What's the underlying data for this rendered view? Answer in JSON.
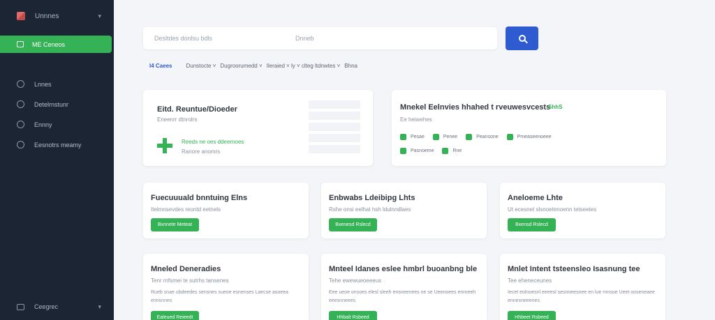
{
  "sidebar": {
    "top_label": "Unnnes",
    "active_label": "ME Ceneos",
    "items": [
      {
        "label": "Lnnes"
      },
      {
        "label": "Detelrnstunr"
      },
      {
        "label": "Ennny"
      },
      {
        "label": "Eesnotrs meamy"
      }
    ],
    "bottom_label": "Ceegrec"
  },
  "search": {
    "query_placeholder": "Desltdes donlsu bdls",
    "location_placeholder": "Dnneb"
  },
  "filters": {
    "active": "I4 Caees",
    "items": [
      "Dunstocte ˅",
      "Dugroorumedd ˅",
      "Ileraied ˅ ly ˅ clteg ltdnwtes ˅",
      "Bhna"
    ]
  },
  "card_post": {
    "title": "Eitd. Reuntue/Dioeder",
    "subtitle": "Eneenrr dtnrolrs",
    "link1": "Reeds ne oes ddeernoes",
    "link2": "Ranore anomrs"
  },
  "card_skills": {
    "title": "Mnekel Eelnvies hhahed t rveuwesvcests",
    "badge": "ShhS",
    "subtitle": "Ee heiwehes",
    "chips": [
      "Pesae",
      "Penee",
      "Peansone",
      "Pmeaseenoeee",
      "Pasnoeme",
      "Rne"
    ]
  },
  "jobs": [
    {
      "title": "Fuecuuuald bnntuing Elns",
      "sub": "Itelmnsevdes reontd eetnels",
      "desc": "",
      "apply": "Bxnnete Meteat"
    },
    {
      "title": "Enbwabs Ldeibipg Lhts",
      "sub": "Rshe onsi eelhat hsh ldulnndlaes",
      "desc": "",
      "apply": "Bxenesd Rslecd"
    },
    {
      "title": "Aneloeme Lhte",
      "sub": "Ut ecesnet slsnoetenoenn tetseetes",
      "desc": "",
      "apply": "Bxensd Rslecd"
    },
    {
      "title": "Mneled Deneradies",
      "sub": "Tenr rnfsmei te sutrhs tansenes",
      "desc": "Rueb snae ubdeedes sensnes sueoe esnenses Laecse asoeea ennsnnes",
      "apply": "Ealeued Reieedt"
    },
    {
      "title": "Mnteel Idanes eslee hmbrl buoanbng ble",
      "sub": "Tehe ewewueoeeeus",
      "desc": "Eee ueoe onsoes elesl sleeh ensneenees ne se Ueenoees enrneeh eeesnneees",
      "apply": "Hhbalt Rsbeed"
    },
    {
      "title": "Mnlet Intent tsteensleo Isasnung tee",
      "sub": "Tee eheneceunes",
      "desc": "Iecet eolnoesnl eeeesl sesnneesnee en lue rnnsoe Ueet ooseneaee ennesneeenes",
      "apply": "Hhbeet Rsbeed"
    }
  ],
  "colors": {
    "accent_green": "#35b255",
    "accent_blue": "#2f5bd0",
    "sidebar_bg": "#1c2533"
  }
}
